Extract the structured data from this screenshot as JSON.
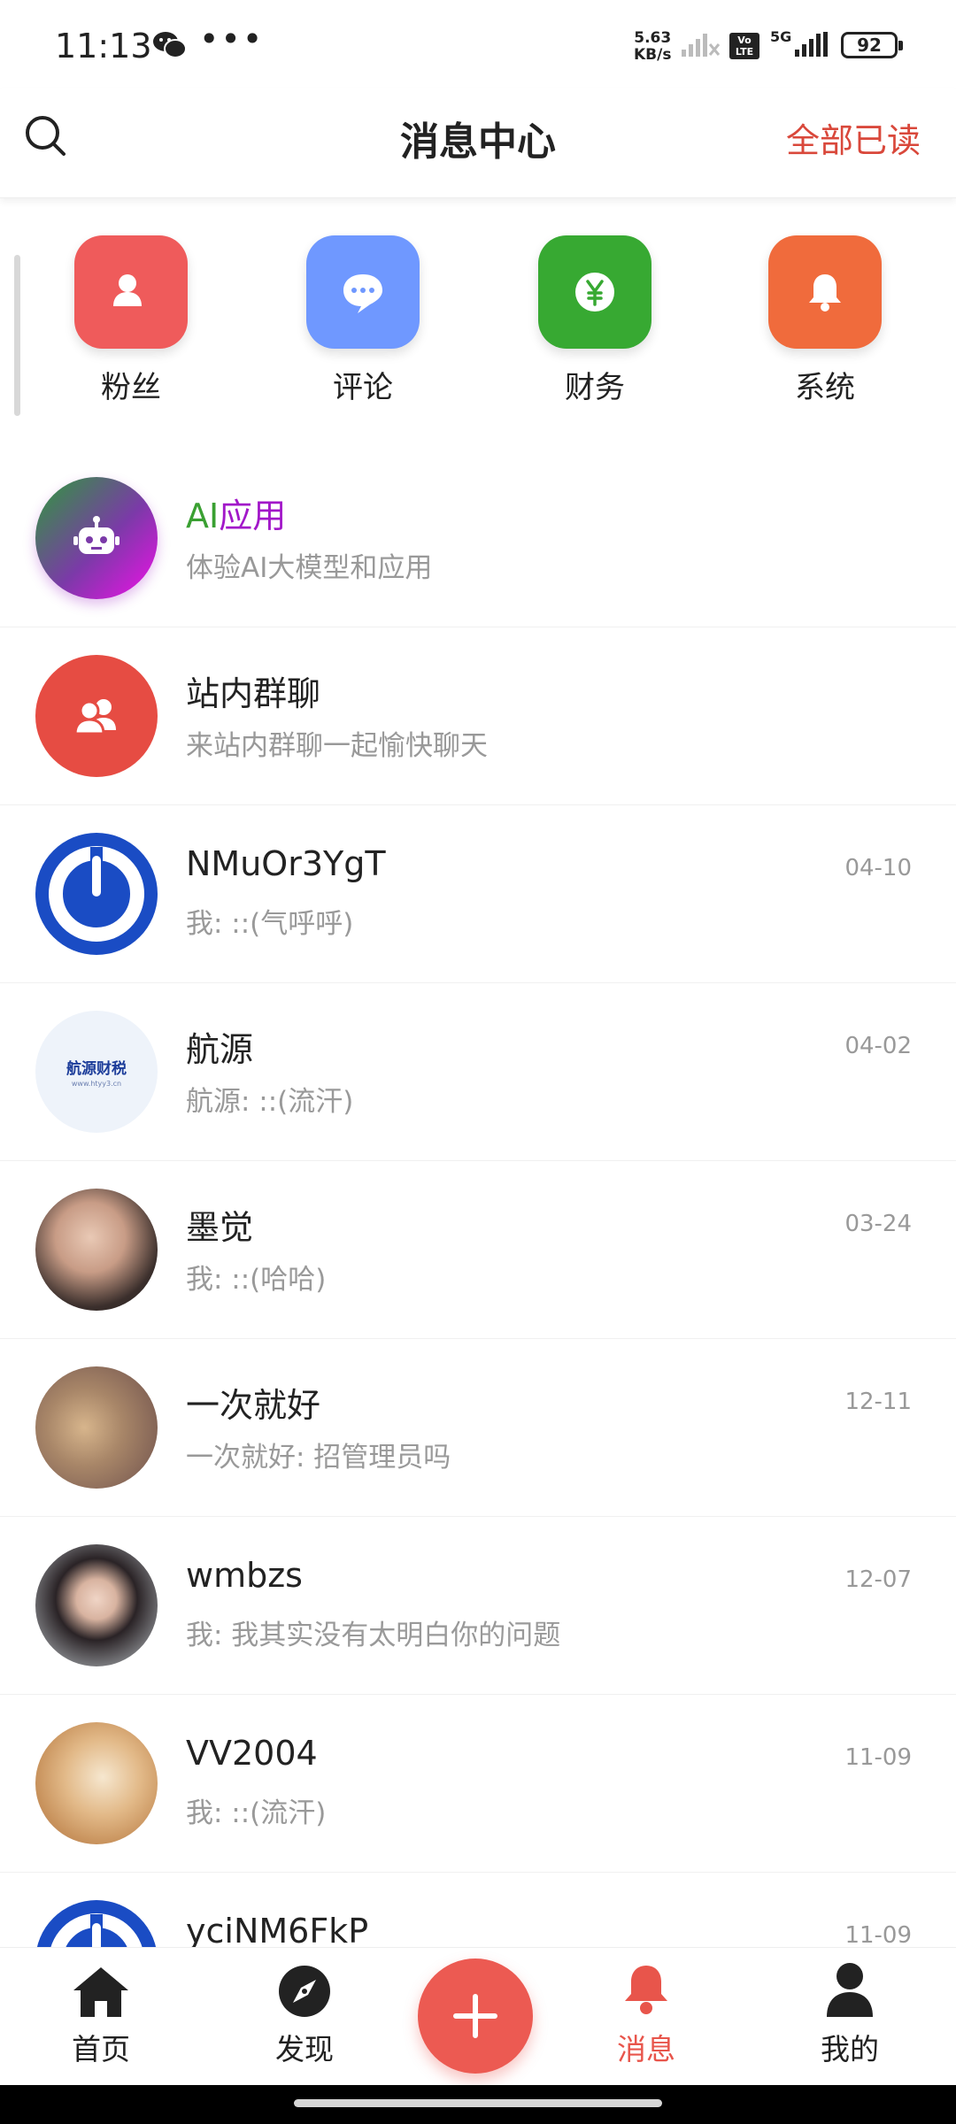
{
  "status_bar": {
    "time": "11:13",
    "dots": "•••",
    "net_speed_value": "5.63",
    "net_speed_unit": "KB/s",
    "volte": "Vo LTE",
    "network": "5G",
    "battery": "92"
  },
  "header": {
    "title": "消息中心",
    "mark_all_read": "全部已读"
  },
  "categories": [
    {
      "label": "粉丝",
      "icon": "user-add-icon",
      "color": "#ef5b5b"
    },
    {
      "label": "评论",
      "icon": "chat-bubble-icon",
      "color": "#6f98ff"
    },
    {
      "label": "财务",
      "icon": "yen-coin-icon",
      "color": "#37a932"
    },
    {
      "label": "系统",
      "icon": "bell-icon",
      "color": "#f06b3c"
    }
  ],
  "messages": [
    {
      "name_a": "AI",
      "name_b": "应用",
      "preview": "体验AI大模型和应用",
      "date": ""
    },
    {
      "name": "站内群聊",
      "preview": "来站内群聊一起愉快聊天",
      "date": ""
    },
    {
      "name": "NMuOr3YgT",
      "preview": "我: ::(气呼呼)",
      "date": "04-10"
    },
    {
      "name": "航源",
      "preview": "航源: ::(流汗)",
      "date": "04-02",
      "avatar_text": "航源财税",
      "avatar_subtext": "www.htyy3.cn"
    },
    {
      "name": "墨觉",
      "preview": "我: ::(哈哈)",
      "date": "03-24"
    },
    {
      "name": "一次就好",
      "preview": "一次就好: 招管理员吗",
      "date": "12-11"
    },
    {
      "name": "wmbzs",
      "preview": "我: 我其实没有太明白你的问题",
      "date": "12-07"
    },
    {
      "name": "VV2004",
      "preview": "我: ::(流汗)",
      "date": "11-09"
    },
    {
      "name": "yciNM6FkP",
      "preview": "",
      "date": "11-09"
    }
  ],
  "bottom_nav": {
    "home": "首页",
    "discover": "发现",
    "messages": "消息",
    "mine": "我的",
    "active": "messages",
    "accent": "#e8554b"
  }
}
